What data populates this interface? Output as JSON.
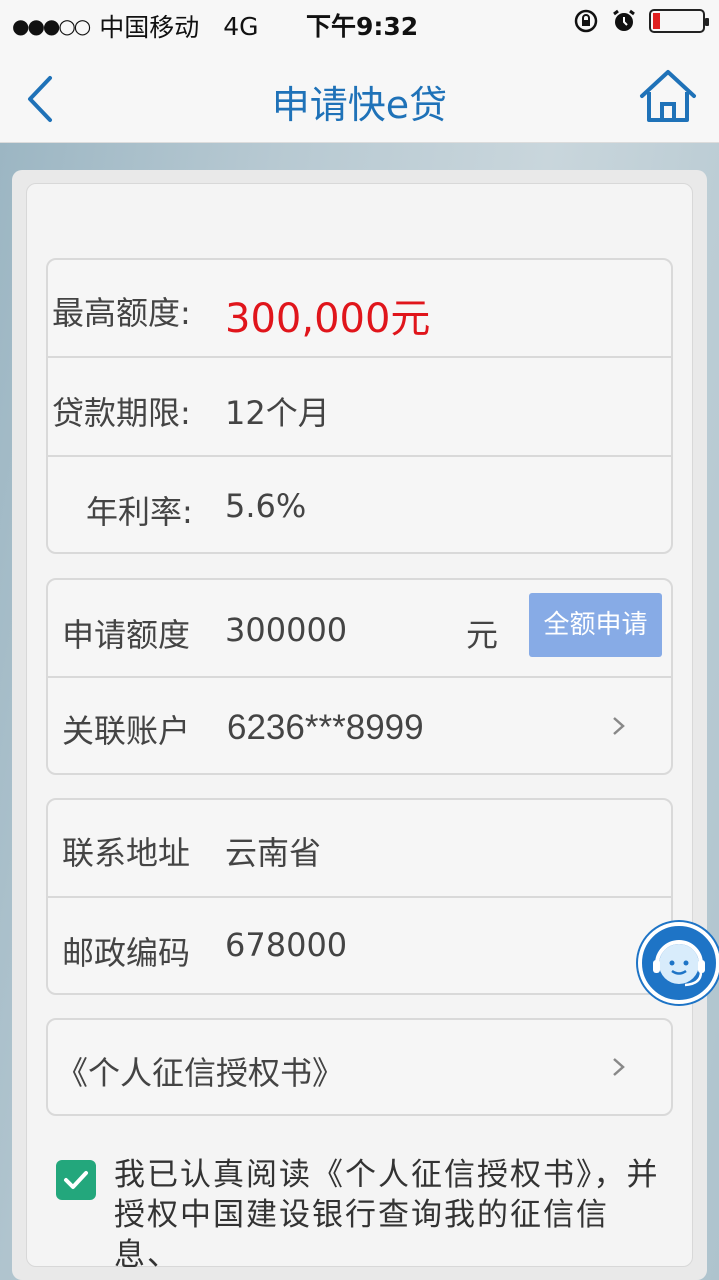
{
  "status": {
    "signal": "●●●○○",
    "carrier": "中国移动",
    "network": "4G",
    "time": "下午9:32"
  },
  "nav": {
    "title": "申请快e贷"
  },
  "loan_info": {
    "max_label": "最高额度:",
    "max_value": "300,000元",
    "term_label": "贷款期限:",
    "term_value": "12个月",
    "rate_label": "年利率:",
    "rate_value": "5.6%"
  },
  "apply": {
    "amount_label": "申请额度",
    "amount_value": "300000",
    "amount_unit": "元",
    "full_button": "全额申请",
    "account_label": "关联账户",
    "account_value": "6236***8999"
  },
  "contact": {
    "address_label": "联系地址",
    "address_value": "云南省",
    "postcode_label": "邮政编码",
    "postcode_value": "678000"
  },
  "auth": {
    "doc_label": "《个人征信授权书》",
    "agree_line1": "我已认真阅读《个人征信授权书》，并",
    "agree_line2": "授权中国建设银行查询我的征信信息、",
    "agree_checked": true
  },
  "icons": {
    "back": "chevron-left-icon",
    "home": "home-icon",
    "chevron": "chevron-right-icon",
    "checkbox": "checkmark-icon",
    "service": "customer-service-icon"
  },
  "colors": {
    "accent": "#1f72b8",
    "amount_red": "#e0151b",
    "button_blue": "#87abe6",
    "check_green": "#23a77c",
    "service_blue": "#1e74c6"
  }
}
